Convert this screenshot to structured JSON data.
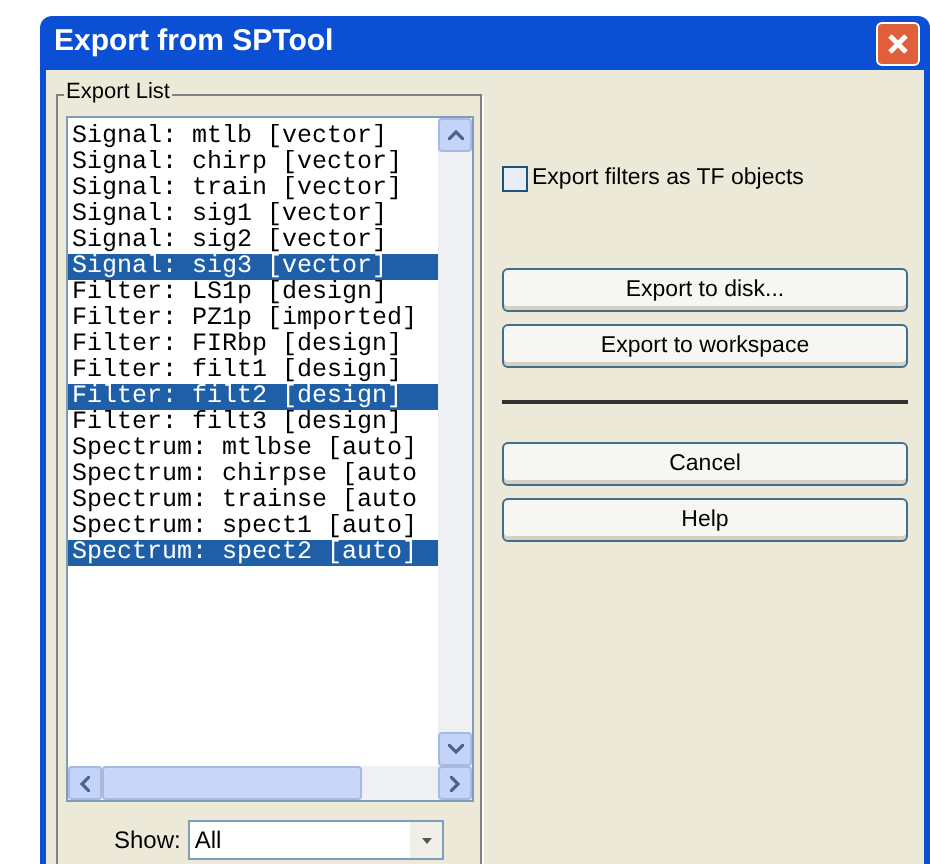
{
  "window": {
    "title": "Export from SPTool"
  },
  "export_list": {
    "label": "Export List",
    "items": [
      {
        "text": "Signal: mtlb [vector]",
        "selected": false
      },
      {
        "text": "Signal: chirp [vector]",
        "selected": false
      },
      {
        "text": "Signal: train [vector]",
        "selected": false
      },
      {
        "text": "Signal: sig1 [vector]",
        "selected": false
      },
      {
        "text": "Signal: sig2 [vector]",
        "selected": false
      },
      {
        "text": "Signal: sig3 [vector]",
        "selected": true
      },
      {
        "text": "Filter: LS1p [design]",
        "selected": false
      },
      {
        "text": "Filter: PZ1p [imported]",
        "selected": false
      },
      {
        "text": "Filter: FIRbp [design]",
        "selected": false
      },
      {
        "text": "Filter: filt1 [design]",
        "selected": false
      },
      {
        "text": "Filter: filt2 [design]",
        "selected": true
      },
      {
        "text": "Filter: filt3 [design]",
        "selected": false
      },
      {
        "text": "Spectrum: mtlbse [auto]",
        "selected": false
      },
      {
        "text": "Spectrum: chirpse [auto",
        "selected": false
      },
      {
        "text": "Spectrum: trainse [auto",
        "selected": false
      },
      {
        "text": "Spectrum: spect1 [auto]",
        "selected": false
      },
      {
        "text": "Spectrum: spect2 [auto]",
        "selected": true
      }
    ],
    "show": {
      "label": "Show:",
      "value": "All"
    }
  },
  "tf_checkbox": {
    "label": "Export filters as TF objects",
    "checked": false
  },
  "buttons_top": [
    "Export to disk...",
    "Export to workspace"
  ],
  "buttons_bottom": [
    "Cancel",
    "Help"
  ]
}
